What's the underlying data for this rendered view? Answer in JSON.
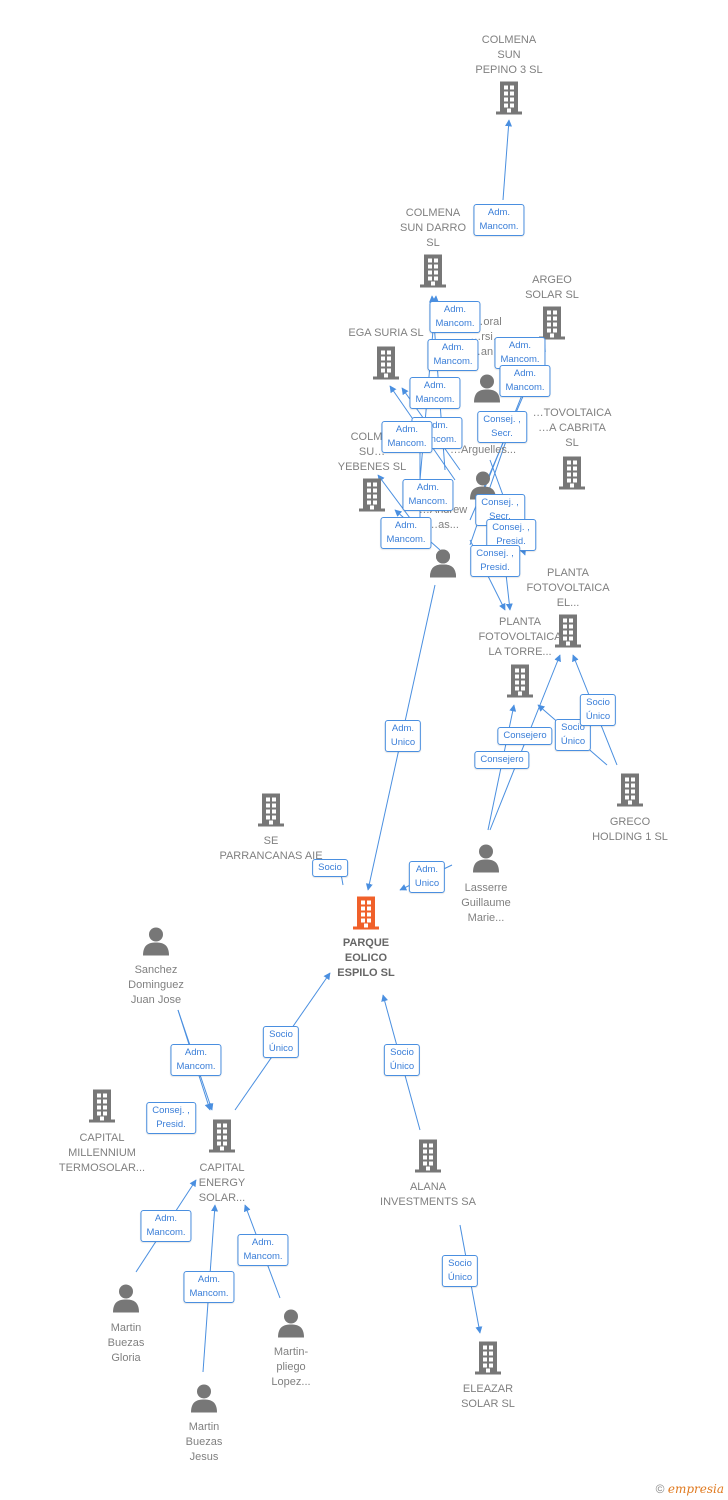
{
  "colors": {
    "edge": "#4a8fe0",
    "node": "#777777",
    "main": "#f0602a"
  },
  "nodes": [
    {
      "id": "pepino",
      "type": "company",
      "label": [
        "COLMENA",
        "SUN",
        "PEPINO 3  SL"
      ]
    },
    {
      "id": "darro",
      "type": "company",
      "label": [
        "COLMENA",
        "SUN DARRO",
        "SL"
      ]
    },
    {
      "id": "argeo",
      "type": "company",
      "label": [
        "ARGEO",
        "SOLAR  SL"
      ]
    },
    {
      "id": "ega",
      "type": "company",
      "label": [
        "EGA SURIA  SL"
      ]
    },
    {
      "id": "yebenes",
      "type": "company",
      "label": [
        "COLM…",
        "SU…",
        "YEBENES  SL"
      ]
    },
    {
      "id": "cabrita",
      "type": "company",
      "label": [
        "…TOVOLTAICA",
        "…A CABRITA",
        "SL"
      ]
    },
    {
      "id": "el",
      "type": "company",
      "label": [
        "PLANTA",
        "FOTOVOLTAICA",
        "EL..."
      ]
    },
    {
      "id": "torre",
      "type": "company",
      "label": [
        "PLANTA",
        "FOTOVOLTAICA",
        "LA TORRE..."
      ]
    },
    {
      "id": "greco",
      "type": "company",
      "label": [
        "GRECO",
        "HOLDING 1  SL"
      ]
    },
    {
      "id": "lasserre",
      "type": "person",
      "label": [
        "Lasserre",
        "Guillaume",
        "Marie..."
      ]
    },
    {
      "id": "se",
      "type": "company",
      "label": [
        "SE",
        "PARRANCANAS AIE"
      ]
    },
    {
      "id": "parque",
      "type": "main",
      "label": [
        "PARQUE",
        "EOLICO",
        "ESPILO  SL"
      ]
    },
    {
      "id": "sanchez",
      "type": "person",
      "label": [
        "Sanchez",
        "Dominguez",
        "Juan Jose"
      ]
    },
    {
      "id": "millennium",
      "type": "company",
      "label": [
        "CAPITAL",
        "MILLENNIUM",
        "TERMOSOLAR..."
      ]
    },
    {
      "id": "energy",
      "type": "company",
      "label": [
        "CAPITAL",
        "ENERGY",
        "SOLAR..."
      ]
    },
    {
      "id": "alana",
      "type": "company",
      "label": [
        "ALANA",
        "INVESTMENTS SA"
      ]
    },
    {
      "id": "gloria",
      "type": "person",
      "label": [
        "Martin",
        "Buezas",
        "Gloria"
      ]
    },
    {
      "id": "pliego",
      "type": "person",
      "label": [
        "Martin-",
        "pliego",
        "Lopez..."
      ]
    },
    {
      "id": "jesus",
      "type": "person",
      "label": [
        "Martin",
        "Buezas",
        "Jesus"
      ]
    },
    {
      "id": "eleazar",
      "type": "company",
      "label": [
        "ELEAZAR",
        "SOLAR  SL"
      ]
    },
    {
      "id": "p1",
      "type": "person",
      "label": [
        "…oral",
        "…rsi…",
        "…an…"
      ]
    },
    {
      "id": "p2",
      "type": "person",
      "label": [
        "…Arguelles..."
      ]
    },
    {
      "id": "p3",
      "type": "person",
      "label": [
        "…Andrew",
        "…as..."
      ]
    },
    {
      "id": "p4",
      "type": "person",
      "label": []
    }
  ],
  "edges": [
    {
      "label": [
        "Adm.",
        "Mancom."
      ]
    },
    {
      "label": [
        "Adm.",
        "Mancom."
      ]
    },
    {
      "label": [
        "Adm.",
        "Mancom."
      ]
    },
    {
      "label": [
        "Adm.",
        "Mancom."
      ]
    },
    {
      "label": [
        "Adm.",
        "Mancom."
      ]
    },
    {
      "label": [
        "Adm.",
        "Mancom."
      ]
    },
    {
      "label": [
        "Adm.",
        "Mancom."
      ]
    },
    {
      "label": [
        "Adm.",
        "Mancom."
      ]
    },
    {
      "label": [
        "Adm.",
        "Mancom."
      ]
    },
    {
      "label": [
        "Adm.",
        "Mancom."
      ]
    },
    {
      "label": [
        "Consej. ,",
        "Secr."
      ]
    },
    {
      "label": [
        "Consej. ,",
        "Secr."
      ]
    },
    {
      "label": [
        "Consej. ,",
        "Presid."
      ]
    },
    {
      "label": [
        "Consej. ,",
        "Presid."
      ]
    },
    {
      "label": [
        "Adm.",
        "Unico"
      ]
    },
    {
      "label": [
        "Socio"
      ]
    },
    {
      "label": [
        "Adm.",
        "Unico"
      ]
    },
    {
      "label": [
        "Consejero"
      ]
    },
    {
      "label": [
        "Consejero"
      ]
    },
    {
      "label": [
        "Socio",
        "Único"
      ]
    },
    {
      "label": [
        "Socio",
        "Único"
      ]
    },
    {
      "label": [
        "Socio",
        "Único"
      ]
    },
    {
      "label": [
        "Socio",
        "Único"
      ]
    },
    {
      "label": [
        "Adm.",
        "Mancom."
      ]
    },
    {
      "label": [
        "Consej. ,",
        "Presid."
      ]
    },
    {
      "label": [
        "Adm.",
        "Mancom."
      ]
    },
    {
      "label": [
        "Adm.",
        "Mancom."
      ]
    },
    {
      "label": [
        "Adm.",
        "Mancom."
      ]
    },
    {
      "label": [
        "Socio",
        "Único"
      ]
    }
  ],
  "footer": {
    "copyright": "©",
    "brand": "empresia"
  }
}
